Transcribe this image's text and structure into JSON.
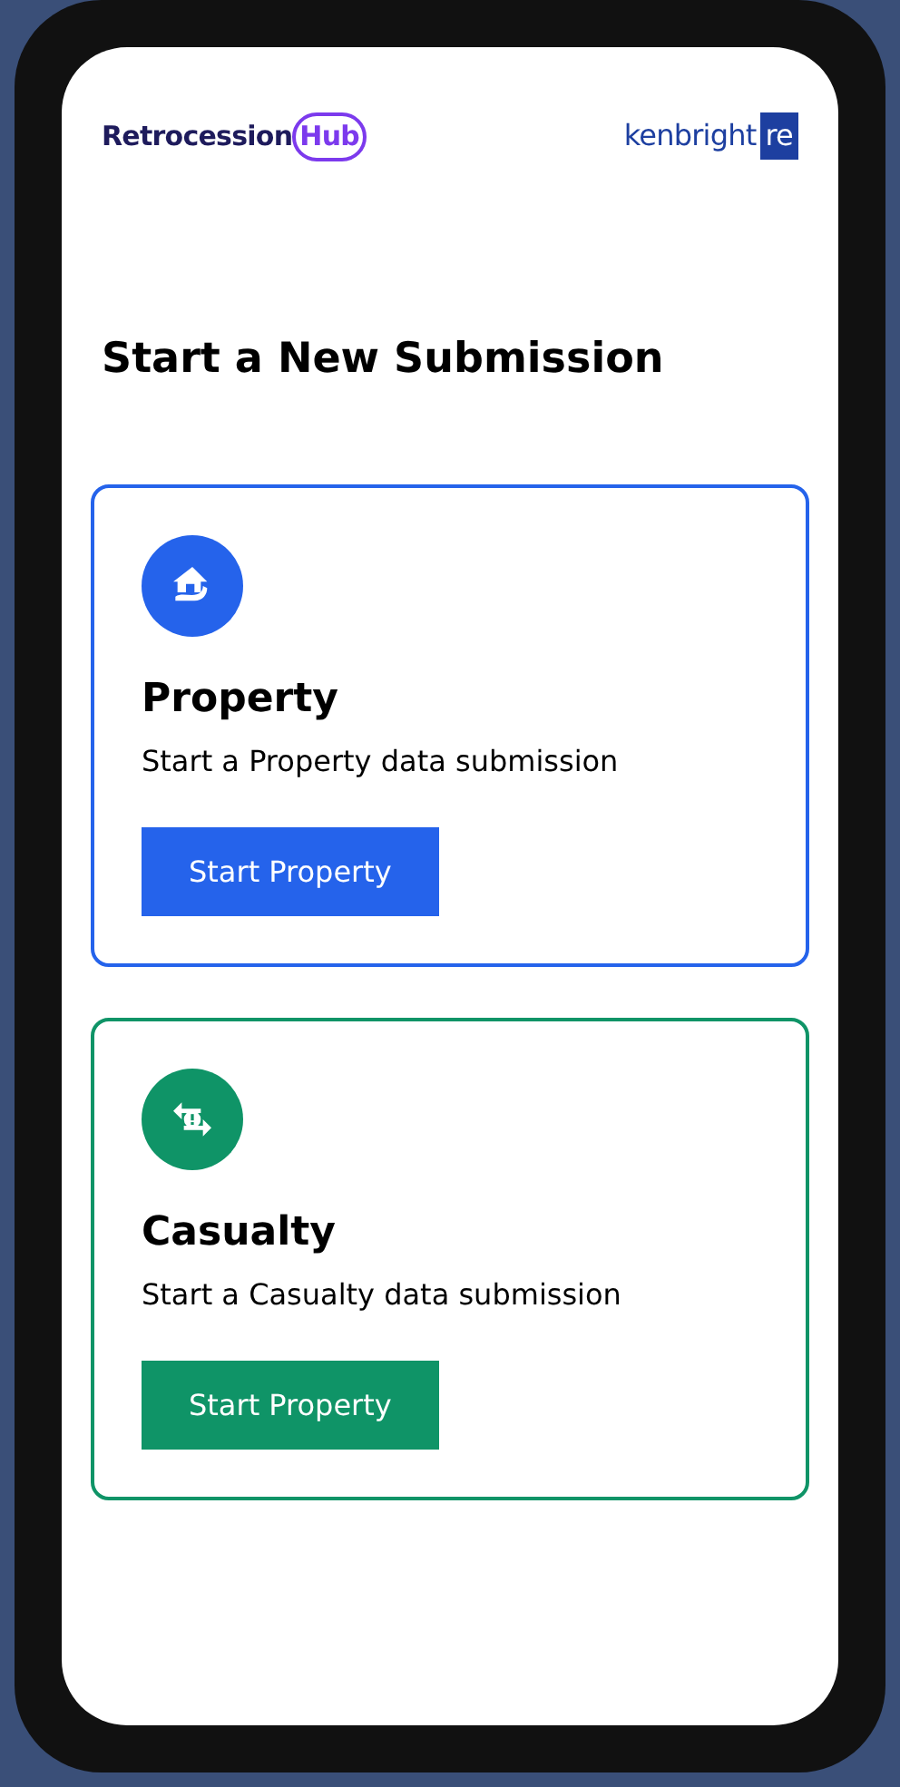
{
  "header": {
    "logo_left": {
      "text": "Retrocession",
      "highlight": "Hub"
    },
    "logo_right": {
      "text": "kenbright",
      "badge": "re"
    }
  },
  "title": "Start a New Submission",
  "cards": [
    {
      "kind": "property",
      "color": "#2563eb",
      "title": "Property",
      "description": "Start a Property data submission",
      "button": "Start Property"
    },
    {
      "kind": "casualty",
      "color": "#0f9467",
      "title": "Casualty",
      "description": "Start a Casualty data submission",
      "button": "Start Property"
    }
  ]
}
